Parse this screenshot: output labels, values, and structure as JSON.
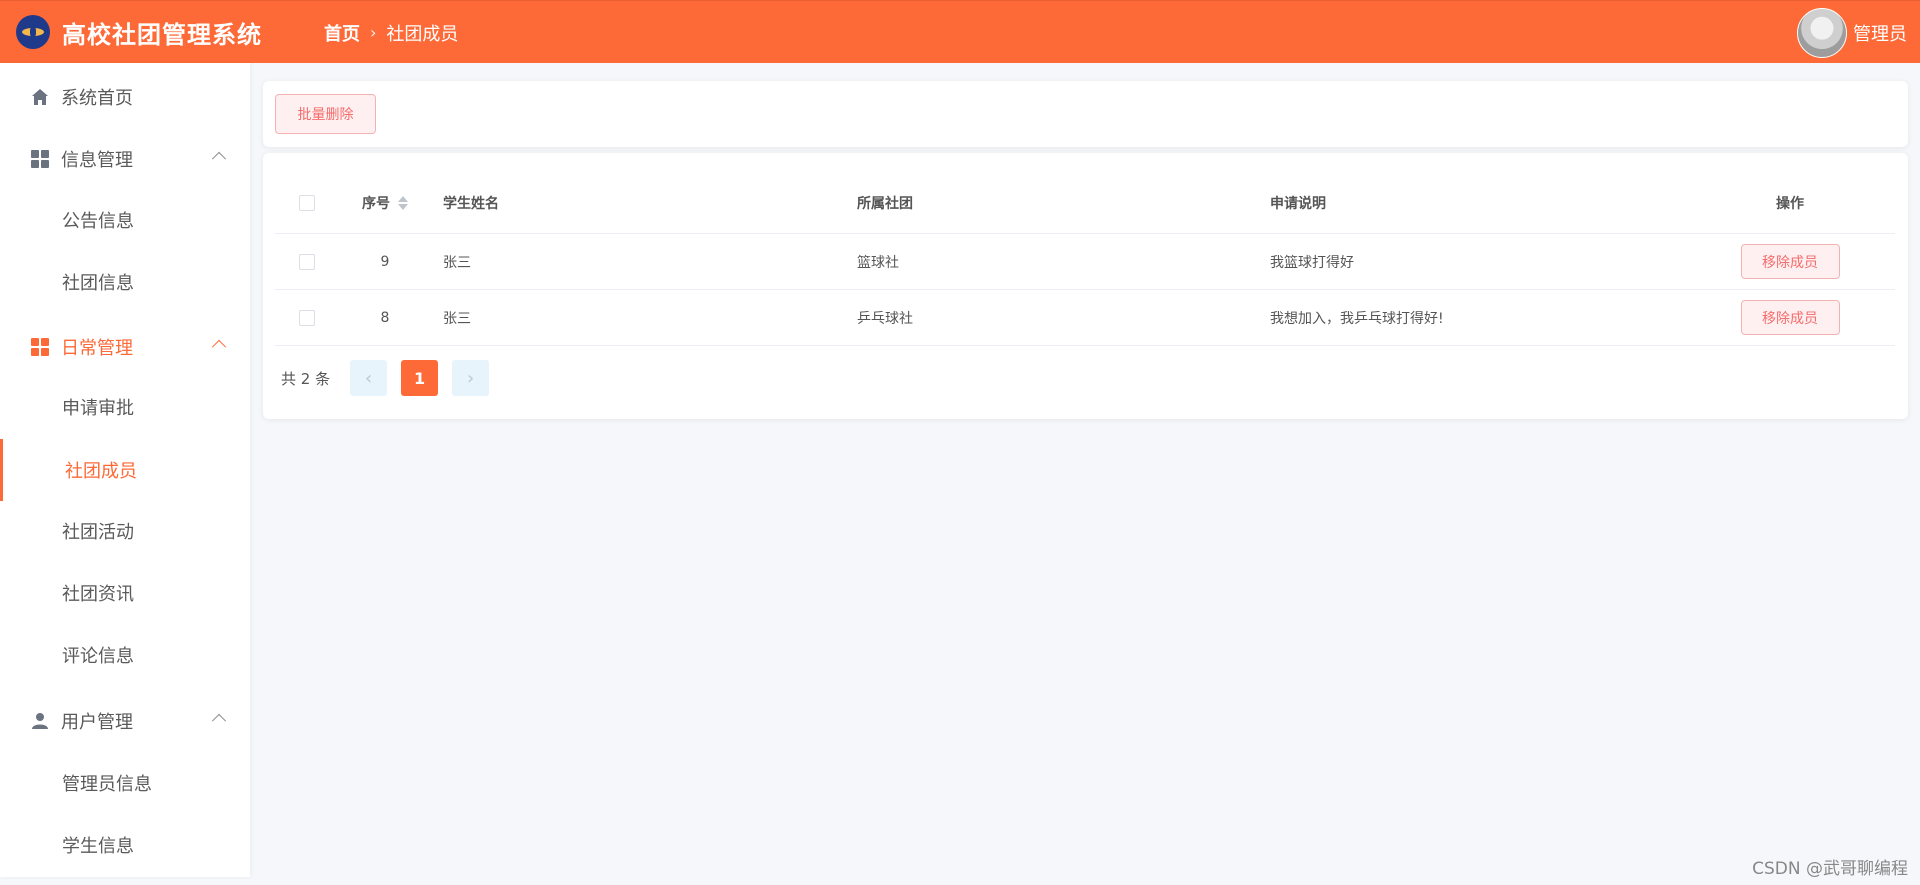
{
  "header": {
    "app_title": "高校社团管理系统",
    "breadcrumb_home": "首页",
    "breadcrumb_separator": "›",
    "breadcrumb_current": "社团成员",
    "user_name": "管理员",
    "accent_color": "#fd6a37"
  },
  "sidebar": {
    "home": "系统首页",
    "info_group": "信息管理",
    "notice_info": "公告信息",
    "club_info": "社团信息",
    "daily_group": "日常管理",
    "apply_review": "申请审批",
    "club_members": "社团成员",
    "club_activity": "社团活动",
    "club_news": "社团资讯",
    "comment_info": "评论信息",
    "user_group": "用户管理",
    "admin_info": "管理员信息",
    "student_info": "学生信息"
  },
  "toolbar": {
    "batch_delete": "批量删除"
  },
  "table": {
    "headers": {
      "index": "序号",
      "student_name": "学生姓名",
      "club": "所属社团",
      "description": "申请说明",
      "operation": "操作"
    },
    "rows": [
      {
        "index": "9",
        "student_name": "张三",
        "club": "篮球社",
        "description": "我篮球打得好",
        "action": "移除成员"
      },
      {
        "index": "8",
        "student_name": "张三",
        "club": "乒乓球社",
        "description": "我想加入，我乒乓球打得好!",
        "action": "移除成员"
      }
    ]
  },
  "pagination": {
    "total": "共 2 条",
    "current_page": "1",
    "prev_icon": "‹",
    "next_icon": "›"
  },
  "watermark": "CSDN @武哥聊编程"
}
